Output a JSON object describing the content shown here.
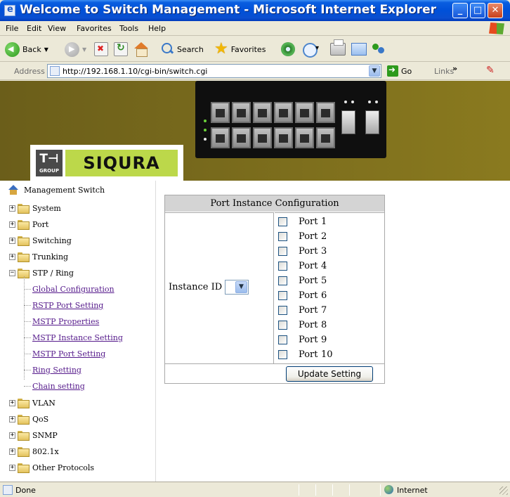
{
  "window": {
    "title": "Welcome to Switch Management - Microsoft Internet Explorer"
  },
  "menu": [
    "File",
    "Edit",
    "View",
    "Favorites",
    "Tools",
    "Help"
  ],
  "toolbar": {
    "back": "Back",
    "search": "Search",
    "favorites": "Favorites"
  },
  "address": {
    "label": "Address",
    "url": "http://192.168.1.10/cgi-bin/switch.cgi",
    "go": "Go",
    "links": "Links",
    "links_more": "»"
  },
  "banner": {
    "logo_th": "T⊣",
    "logo_group": "GROUP",
    "logo_brand": "SIQURA"
  },
  "tree": {
    "root": "Management Switch",
    "folders_top": [
      "System",
      "Port",
      "Switching",
      "Trunking"
    ],
    "open_folder": "STP / Ring",
    "leaves": [
      "Global Configuration",
      "RSTP Port Setting",
      "MSTP Properties",
      "MSTP Instance Setting",
      "MSTP Port Setting",
      "Ring Setting",
      "Chain setting"
    ],
    "folders_bottom": [
      "VLAN",
      "QoS",
      "SNMP",
      "802.1x",
      "Other Protocols"
    ]
  },
  "config": {
    "title": "Port Instance Configuration",
    "instance_label": "Instance ID",
    "instance_value": "",
    "ports": [
      {
        "label": "Port",
        "num": "1",
        "checked": false
      },
      {
        "label": "Port",
        "num": "2",
        "checked": false
      },
      {
        "label": "Port",
        "num": "3",
        "checked": false
      },
      {
        "label": "Port",
        "num": "4",
        "checked": false
      },
      {
        "label": "Port",
        "num": "5",
        "checked": false
      },
      {
        "label": "Port",
        "num": "6",
        "checked": false
      },
      {
        "label": "Port",
        "num": "7",
        "checked": false
      },
      {
        "label": "Port",
        "num": "8",
        "checked": false
      },
      {
        "label": "Port",
        "num": "9",
        "checked": false
      },
      {
        "label": "Port",
        "num": "10",
        "checked": false
      }
    ],
    "update_button": "Update Setting"
  },
  "status": {
    "text": "Done",
    "zone": "Internet"
  }
}
